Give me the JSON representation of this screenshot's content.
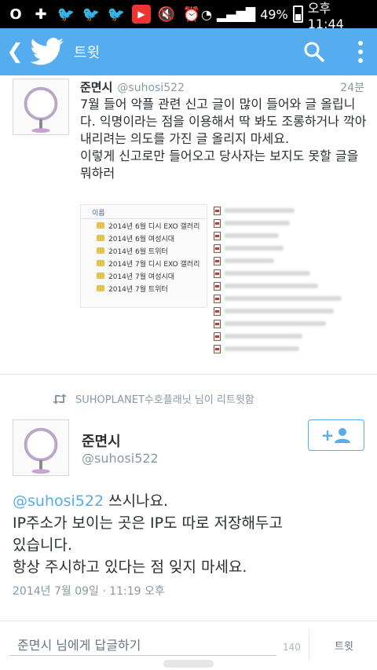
{
  "status_bar": {
    "battery": "49%",
    "time": "오후 11:44"
  },
  "app_bar": {
    "title": "트윗"
  },
  "tweet1": {
    "name": "준면시",
    "handle": "@suhosi522",
    "time": "24분",
    "text": "7월 들어 악플 관련 신고 글이 많이 들어와 글 올립니다. 익명이라는 점을 이용해서 딱 봐도 조롱하거나 깍아내리려는 의도를 가진 글 올리지 마세요.\n이렇게 신고로만 들어오고 당사자는 보지도 못할 글을 뭐하러",
    "image": {
      "header": "이름",
      "folders": [
        "2014년 6월 디시 EXO 갤러리",
        "2014년 6월 여성시대",
        "2014년 6월 트위터",
        "2014년 7월 디시 EXO 갤러리",
        "2014년 7월 여성시대",
        "2014년 7월 트위터"
      ]
    }
  },
  "retweet": {
    "text": "SUHOPLANET수호플래닛 님이 리트윗함"
  },
  "tweet2": {
    "name": "준면시",
    "handle": "@suhosi522",
    "mention": "@suhosi522",
    "text_after_mention": " 쓰시나요.",
    "lines": [
      "IP주소가 보이는 곳은 IP도 따로 저장해두고",
      "있습니다.",
      "항상 주시하고 있다는 점 잊지 마세요."
    ],
    "date": "2014년 7월 09일 · 11:19 오후",
    "follow_symbol": "+"
  },
  "reply": {
    "placeholder": "준면시 님에게 답글하기",
    "count": "140",
    "send_label": "트윗"
  },
  "colors": {
    "brand": "#55acee",
    "text": "#292f33",
    "muted": "#8899a6"
  }
}
